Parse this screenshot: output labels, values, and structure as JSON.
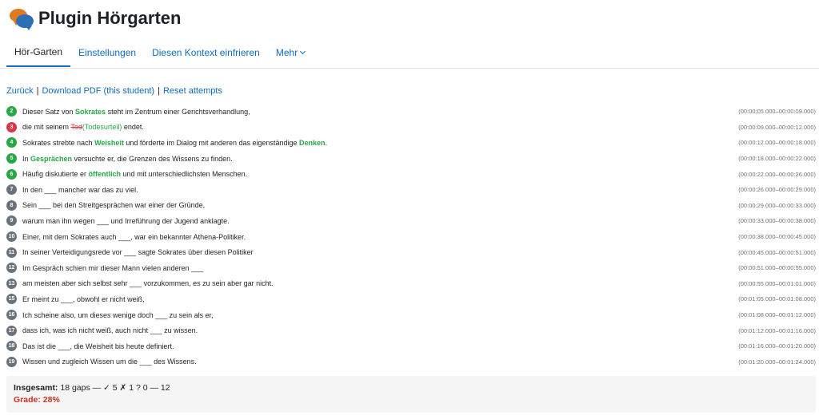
{
  "header": {
    "title": "Plugin Hörgarten",
    "logo_icon": "speech-bubbles-icon"
  },
  "tabs": [
    {
      "label": "Hör-Garten",
      "active": true
    },
    {
      "label": "Einstellungen",
      "active": false
    },
    {
      "label": "Diesen Kontext einfrieren",
      "active": false
    },
    {
      "label": "Mehr",
      "active": false,
      "dropdown": true
    }
  ],
  "actions": {
    "back": "Zurück",
    "separator": "|",
    "download": "Download PDF (this student)",
    "reset": "Reset attempts"
  },
  "colors": {
    "correct": "#28a745",
    "wrong": "#dc3545",
    "pending": "#6a737b",
    "link": "#0f6cbf",
    "grade": "#ca3120"
  },
  "rows": [
    {
      "num": "2",
      "status": "correct",
      "parts": [
        {
          "t": "Dieser Satz von "
        },
        {
          "t": "Sokrates",
          "kw": true
        },
        {
          "t": " steht im Zentrum einer Gerichtsverhandlung,"
        }
      ],
      "time": "(00:00:05.000–00:00:09.000)"
    },
    {
      "num": "3",
      "status": "wrong",
      "parts": [
        {
          "t": "die mit seinem "
        },
        {
          "t": "Tod",
          "wrong": true
        },
        {
          "t": "(Todesurteil)",
          "correct": true
        },
        {
          "t": " endet."
        }
      ],
      "time": "(00:00:09.000–00:00:12.000)"
    },
    {
      "num": "4",
      "status": "correct",
      "parts": [
        {
          "t": "Sokrates strebte nach "
        },
        {
          "t": "Weisheit",
          "kw": true
        },
        {
          "t": " und förderte im Dialog mit anderen das eigenständige "
        },
        {
          "t": "Denken",
          "kw": true
        },
        {
          "t": "."
        }
      ],
      "time": "(00:00:12.000–00:00:18.000)"
    },
    {
      "num": "5",
      "status": "correct",
      "parts": [
        {
          "t": "In "
        },
        {
          "t": "Gesprächen",
          "kw": true
        },
        {
          "t": " versuchte er, die Grenzen des Wissens zu finden."
        }
      ],
      "time": "(00:00:18.000–00:00:22.000)"
    },
    {
      "num": "6",
      "status": "correct",
      "parts": [
        {
          "t": "Häufig diskutierte er "
        },
        {
          "t": "öffentlich",
          "kw": true
        },
        {
          "t": " und mit unterschiedlichsten Menschen."
        }
      ],
      "time": "(00:00:22.000–00:00:26.000)"
    },
    {
      "num": "7",
      "status": "pending",
      "parts": [
        {
          "t": "In den ___ mancher war das zu viel."
        }
      ],
      "time": "(00:00:26.000–00:00:29.000)"
    },
    {
      "num": "8",
      "status": "pending",
      "parts": [
        {
          "t": "Sein ___ bei den Streitgesprächen war einer der Gründe,"
        }
      ],
      "time": "(00:00:29.000–00:00:33.000)"
    },
    {
      "num": "9",
      "status": "pending",
      "parts": [
        {
          "t": "warum man ihn wegen ___ und Irreführung der Jugend anklagte."
        }
      ],
      "time": "(00:00:33.000–00:00:38.000)"
    },
    {
      "num": "10",
      "status": "pending",
      "parts": [
        {
          "t": "Einer, mit dem Sokrates auch ___, war ein bekannter Athena-Politiker."
        }
      ],
      "time": "(00:00:38.000–00:00:45.000)"
    },
    {
      "num": "11",
      "status": "pending",
      "parts": [
        {
          "t": "In seiner Verteidigungsrede vor ___ sagte Sokrates über diesen Politiker"
        }
      ],
      "time": "(00:00:45.000–00:00:51.000)"
    },
    {
      "num": "12",
      "status": "pending",
      "parts": [
        {
          "t": "Im Gespräch schien mir dieser Mann vielen anderen ___"
        }
      ],
      "time": "(00:00:51.000–00:00:55.000)"
    },
    {
      "num": "13",
      "status": "pending",
      "parts": [
        {
          "t": "am meisten aber sich selbst sehr ___ vorzukommen, es zu sein aber gar nicht."
        }
      ],
      "time": "(00:00:55.000–00:01:01.000)"
    },
    {
      "num": "15",
      "status": "pending",
      "parts": [
        {
          "t": "Er meint zu ___, obwohl er nicht weiß,"
        }
      ],
      "time": "(00:01:05.000–00:01:08.000)"
    },
    {
      "num": "16",
      "status": "pending",
      "parts": [
        {
          "t": "Ich scheine also, um dieses wenige doch ___ zu sein als er,"
        }
      ],
      "time": "(00:01:08.000–00:01:12.000)"
    },
    {
      "num": "17",
      "status": "pending",
      "parts": [
        {
          "t": "dass ich, was ich nicht weiß, auch nicht ___ zu wissen."
        }
      ],
      "time": "(00:01:12.000–00:01:16.000)"
    },
    {
      "num": "18",
      "status": "pending",
      "parts": [
        {
          "t": "Das ist die ___, die Weisheit bis heute definiert."
        }
      ],
      "time": "(00:01:16.000–00:01:20.000)"
    },
    {
      "num": "19",
      "status": "pending",
      "parts": [
        {
          "t": "Wissen und zugleich Wissen um die ___ des Wissens."
        }
      ],
      "time": "(00:01:20.000–00:01:24.000)"
    }
  ],
  "summary": {
    "label": "Insgesamt:",
    "stats": "18 gaps — ✓ 5   ✗ 1   ? 0   — 12",
    "grade": "Grade: 28%"
  }
}
